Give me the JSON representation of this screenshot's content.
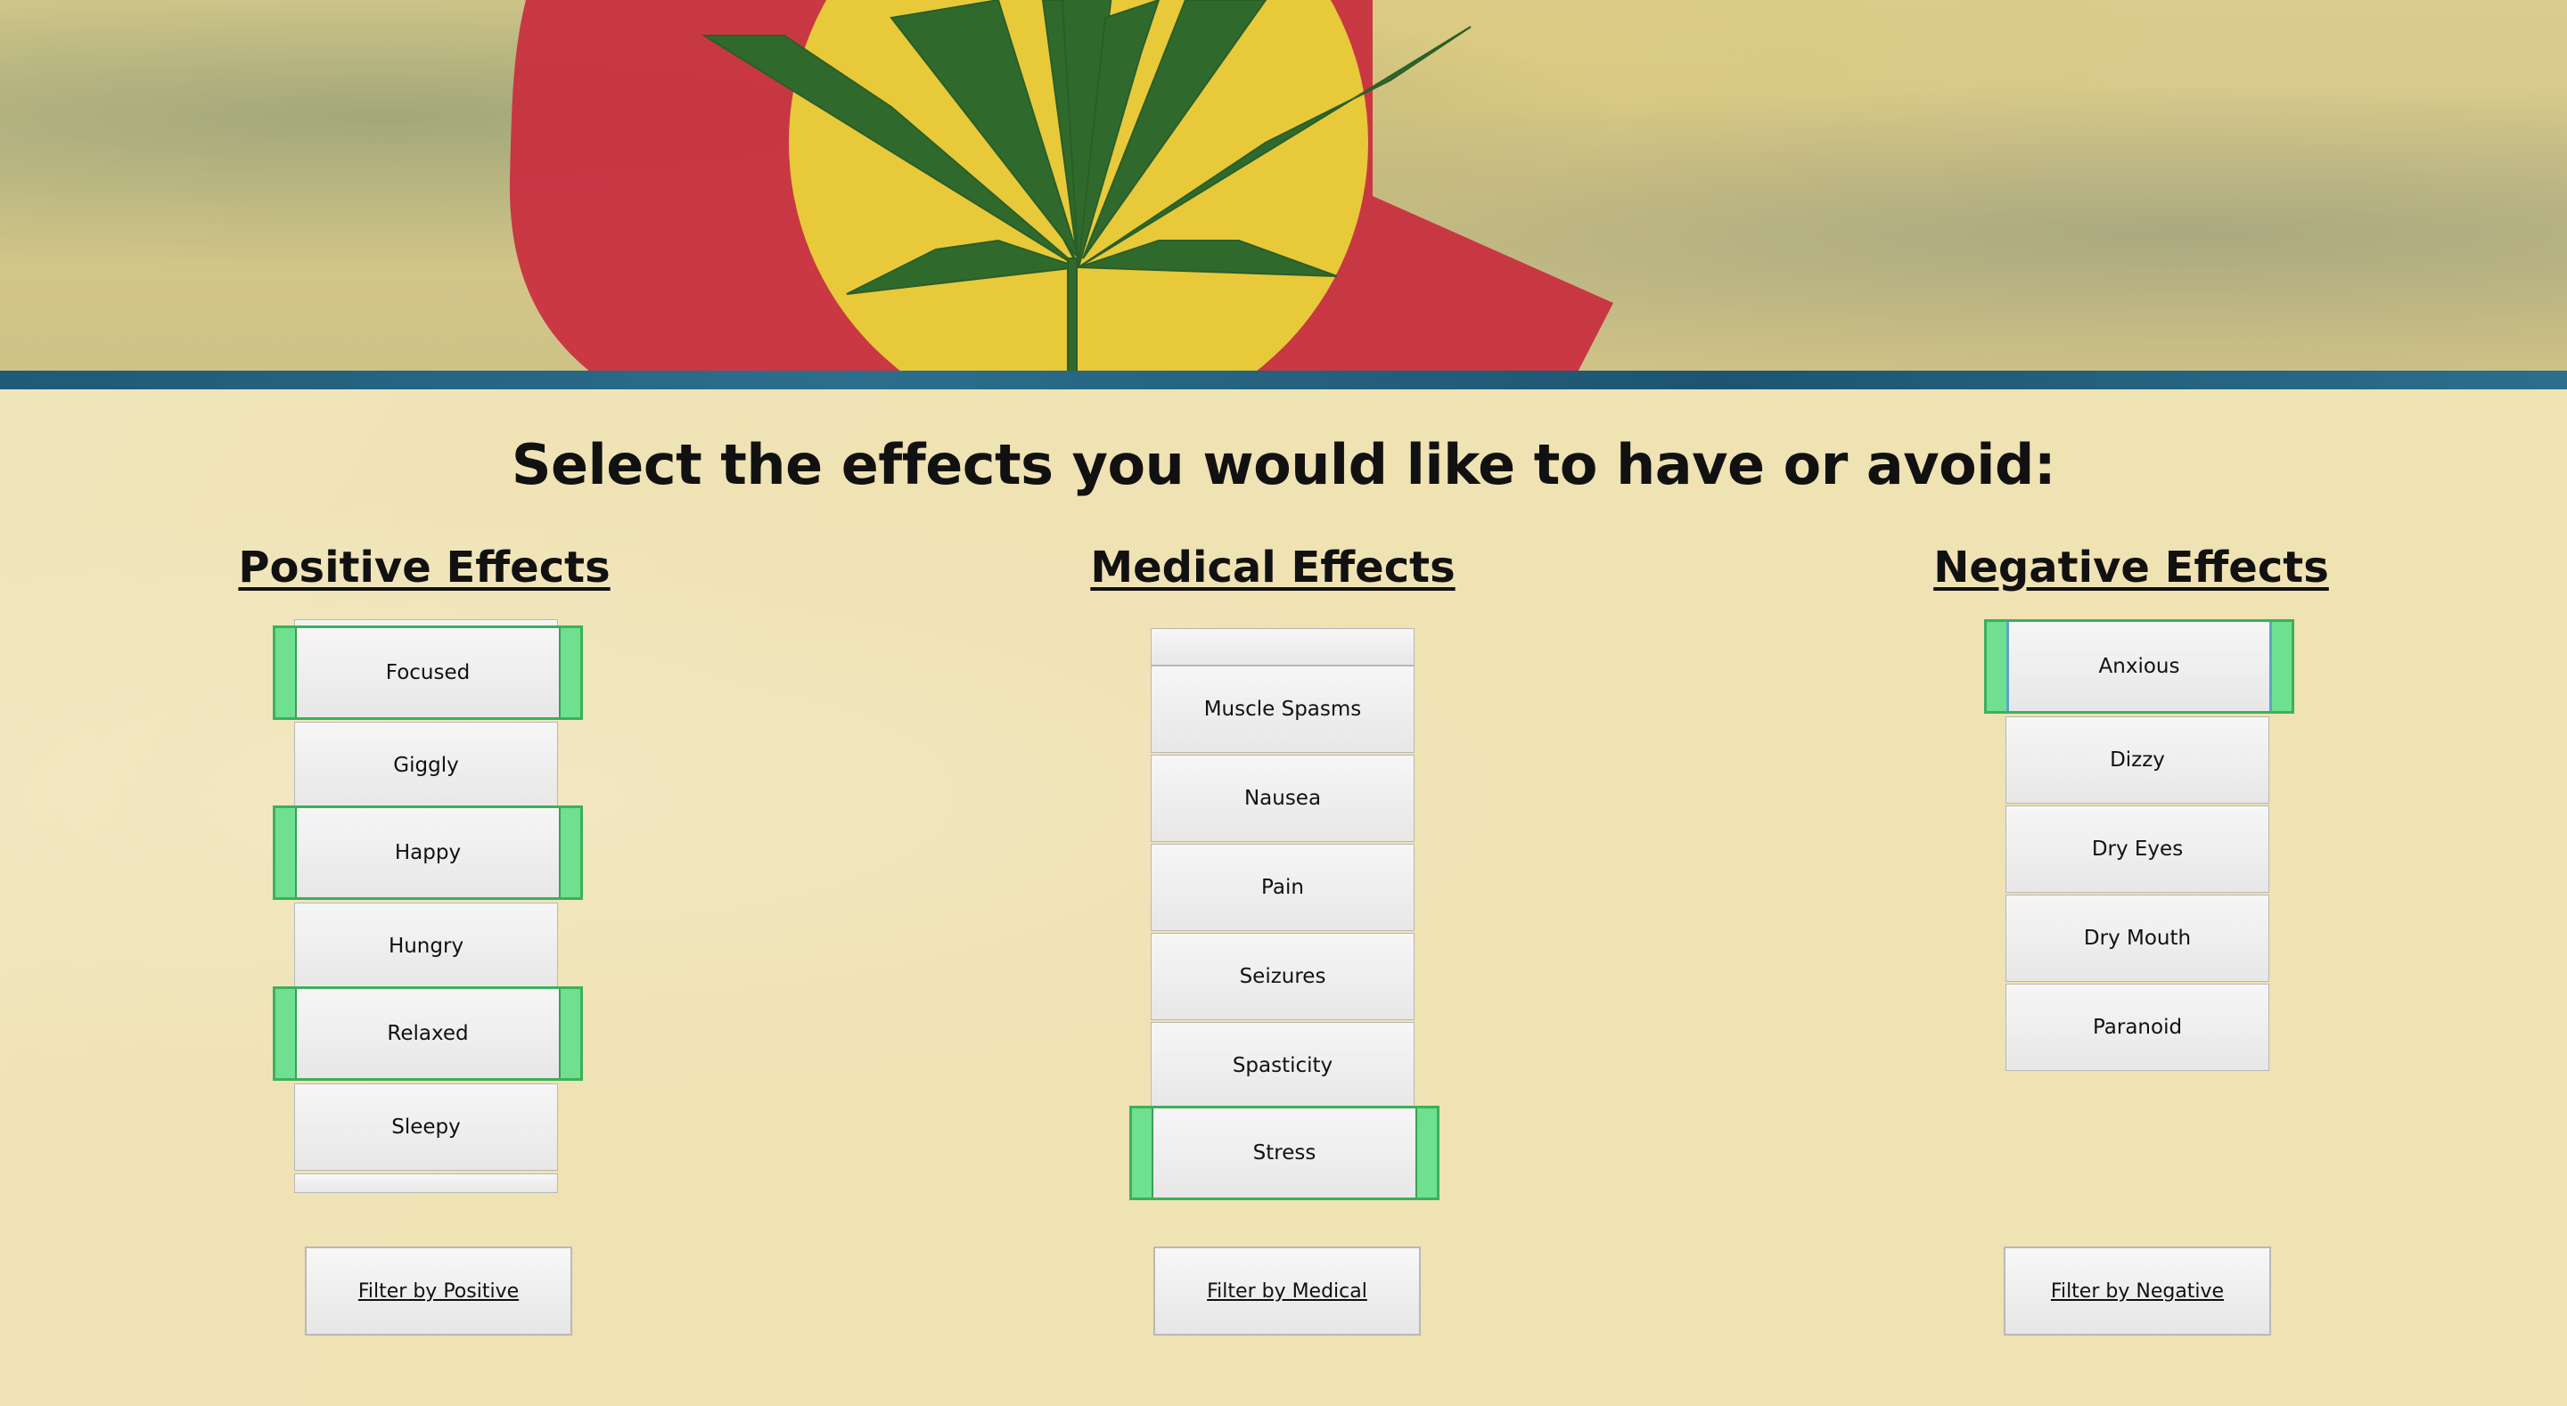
{
  "heading": "Select the effects you would like to have or avoid:",
  "positive": {
    "title": "Positive Effects",
    "options": [
      "Focused",
      "Giggly",
      "Happy",
      "Hungry",
      "Relaxed",
      "Sleepy"
    ],
    "selected": [
      "Focused",
      "Happy",
      "Relaxed"
    ],
    "button": "Filter by Positive"
  },
  "medical": {
    "title": "Medical Effects",
    "options": [
      "Muscle Spasms",
      "Nausea",
      "Pain",
      "Seizures",
      "Spasticity",
      "Stress"
    ],
    "selected": [
      "Stress"
    ],
    "button": "Filter by Medical"
  },
  "negative": {
    "title": "Negative Effects",
    "options": [
      "Anxious",
      "Dizzy",
      "Dry Eyes",
      "Dry Mouth",
      "Paranoid"
    ],
    "selected": [
      "Anxious"
    ],
    "button": "Filter by Negative"
  },
  "colors": {
    "selected_fill": "#6fe08f",
    "selected_border": "#3cb05a",
    "background": "#efe2b3"
  },
  "icons": {
    "banner": "colorado-flag-cannabis-leaf-banner"
  }
}
